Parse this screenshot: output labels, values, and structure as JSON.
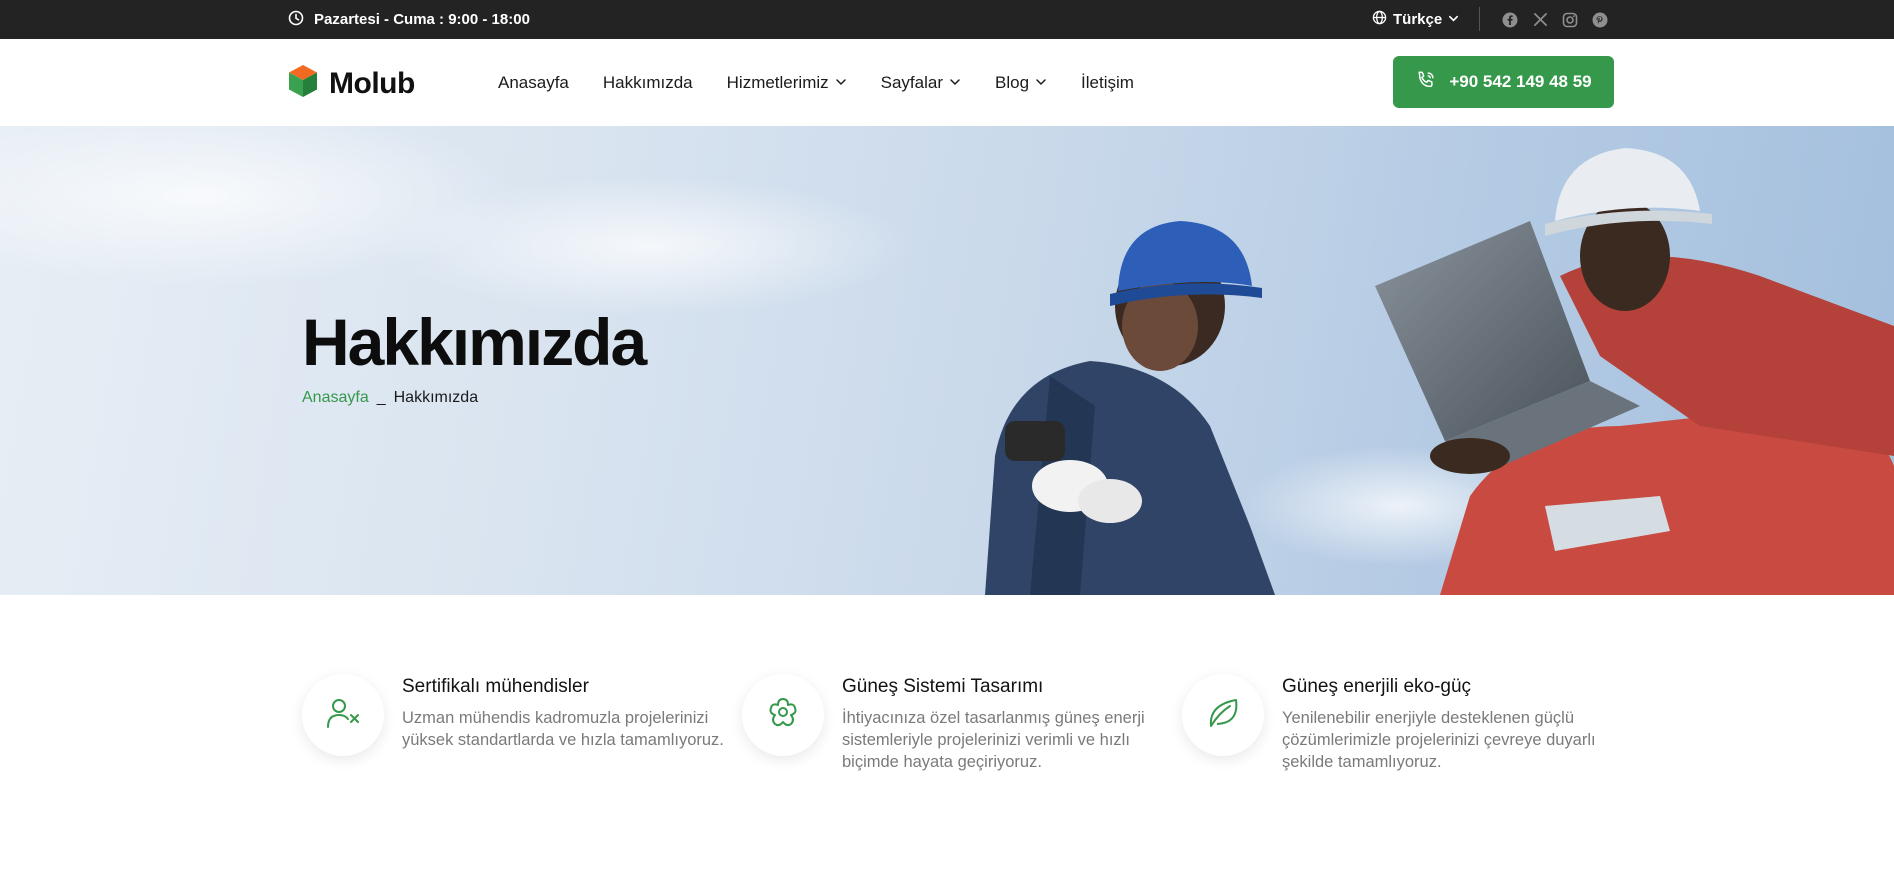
{
  "topbar": {
    "hours": "Pazartesi - Cuma : 9:00 - 18:00",
    "language": "Türkçe",
    "socials": [
      "facebook-icon",
      "x-icon",
      "instagram-icon",
      "pinterest-icon"
    ]
  },
  "header": {
    "logo_text": "Molub",
    "nav": [
      {
        "label": "Anasayfa",
        "dropdown": false
      },
      {
        "label": "Hakkımızda",
        "dropdown": false
      },
      {
        "label": "Hizmetlerimiz",
        "dropdown": true
      },
      {
        "label": "Sayfalar",
        "dropdown": true
      },
      {
        "label": "Blog",
        "dropdown": true
      },
      {
        "label": "İletişim",
        "dropdown": false
      }
    ],
    "phone": "+90 542 149 48 59"
  },
  "hero": {
    "title": "Hakkımızda",
    "breadcrumb": {
      "home": "Anasayfa",
      "separator": "_",
      "current": "Hakkımızda"
    }
  },
  "features": [
    {
      "icon": "user-x-icon",
      "title": "Sertifikalı mühendisler",
      "description": "Uzman mühendis kadromuzla projelerinizi yüksek standartlarda ve hızla tamamlıyoruz."
    },
    {
      "icon": "flower-icon",
      "title": "Güneş Sistemi Tasarımı",
      "description": "İhtiyacınıza özel tasarlanmış güneş enerji sistemleriyle projelerinizi verimli ve hızlı biçimde hayata geçiriyoruz."
    },
    {
      "icon": "leaf-icon",
      "title": "Güneş enerjili eko-güç",
      "description": "Yenilenebilir enerjiyle desteklenen güçlü çözümlerimizle projelerinizi çevreye duyarlı şekilde tamamlıyoruz."
    }
  ],
  "colors": {
    "accent": "#35984b",
    "topbar": "#232323",
    "text": "#1b1b1b",
    "muted": "#7a7a7a"
  }
}
